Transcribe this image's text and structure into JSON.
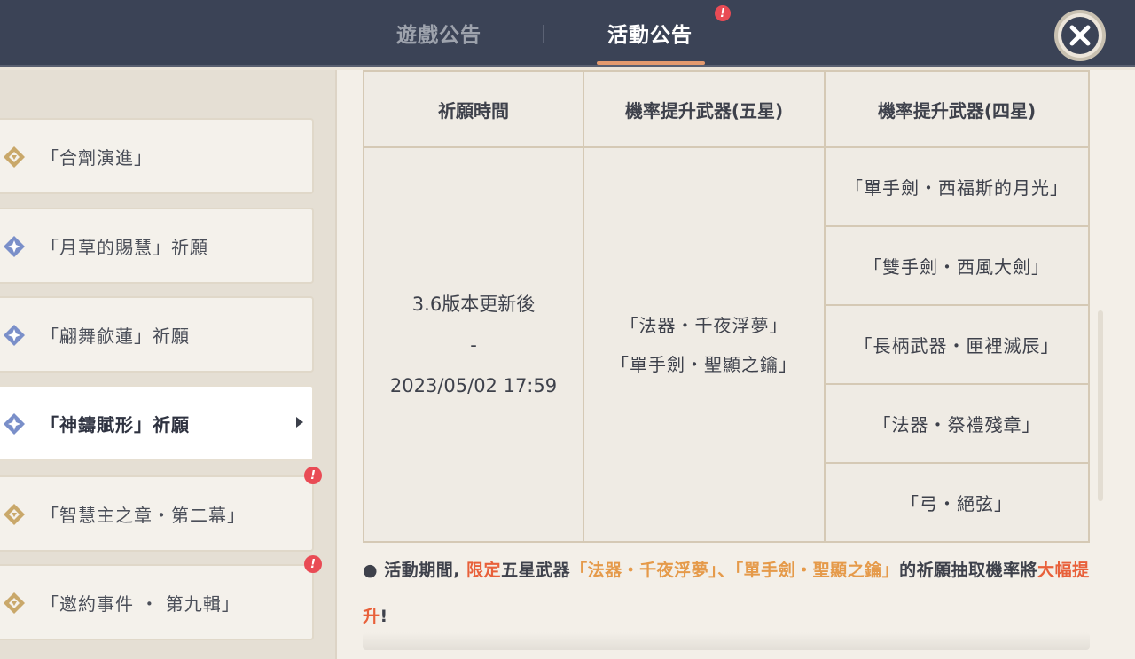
{
  "header": {
    "tabs": [
      {
        "label": "遊戲公告"
      },
      {
        "label": "活動公告"
      }
    ],
    "alert_badge": "!"
  },
  "sidebar": {
    "items": [
      {
        "label": "「合劑演進」",
        "icon": "gold-diamond-icon"
      },
      {
        "label": "「月草的賜慧」祈願",
        "icon": "blue-star-diamond-icon"
      },
      {
        "label": "「翩舞歈蓮」祈願",
        "icon": "blue-star-diamond-icon"
      },
      {
        "label": "「神鑄賦形」祈願",
        "icon": "blue-star-diamond-icon"
      },
      {
        "label": "「智慧主之章・第二幕」",
        "icon": "gold-diamond-icon"
      },
      {
        "label": "「邀約事件 ・ 第九輯」",
        "icon": "gold-diamond-icon"
      }
    ],
    "alert_badge": "!"
  },
  "table": {
    "headers": [
      "祈願時間",
      "機率提升武器(五星)",
      "機率提升武器(四星)"
    ],
    "time": {
      "start": "3.6版本更新後",
      "dash": "-",
      "end": "2023/05/02 17:59"
    },
    "five_star": [
      "「法器・千夜浮夢」",
      "「單手劍・聖顯之鑰」"
    ],
    "four_star": [
      "「單手劍・西福斯的月光」",
      "「雙手劍・西風大劍」",
      "「長柄武器・匣裡滅辰」",
      "「法器・祭禮殘章」",
      "「弓・絕弦」"
    ]
  },
  "note": {
    "bullet": "●",
    "p1": " 活動期間, ",
    "limited": "限定",
    "p2": "五星武器",
    "w1": "「法器・千夜浮夢」",
    "sep": "、",
    "w2": "「單手劍・聖顯之鑰」",
    "p3": "的祈願抽取機率將",
    "big": "大幅提升",
    "end": "!"
  },
  "colors": {
    "topbar": "#3b4356",
    "accent_underline": "#e59a6e",
    "alert": "#e94b55",
    "highlight_red": "#e8603a",
    "highlight_orange": "#e59a4a"
  }
}
